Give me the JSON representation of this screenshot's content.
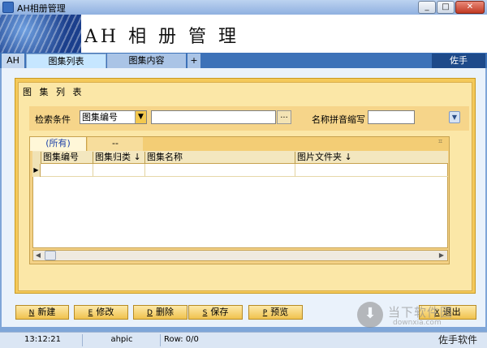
{
  "window": {
    "title": "AH相册管理",
    "min": "_",
    "max": "□",
    "close": "✕"
  },
  "banner": {
    "title": "AH 相 册 管 理"
  },
  "tabs": {
    "ah": "AH",
    "list": "图集列表",
    "content": "图集内容",
    "add": "+",
    "right": "佐手"
  },
  "panel": {
    "title": "图 集 列 表"
  },
  "search": {
    "cond_label": "检索条件",
    "cond_value": "图集编号",
    "browse": "...",
    "pinyin_label": "名称拼音缩写",
    "query_value": "",
    "pinyin_value": ""
  },
  "grid": {
    "tabs": [
      "(所有)",
      "--"
    ],
    "columns": [
      "",
      "图集编号",
      "图集归类 ↓",
      "图集名称",
      "图片文件夹 ↓"
    ]
  },
  "buttons": {
    "new": {
      "key": "N",
      "label": "新建"
    },
    "edit": {
      "key": "E",
      "label": "修改"
    },
    "del": {
      "key": "D",
      "label": "删除"
    },
    "save": {
      "key": "S",
      "label": "保存"
    },
    "preview": {
      "key": "P",
      "label": "预览"
    },
    "exit": {
      "key": "X",
      "label": "退出"
    }
  },
  "status": {
    "time": "13:12:21",
    "user": "ahpic",
    "row": "Row: 0/0",
    "right": "佐手软件"
  },
  "watermark": {
    "text": "当下软件园",
    "url": "downxia.com"
  }
}
